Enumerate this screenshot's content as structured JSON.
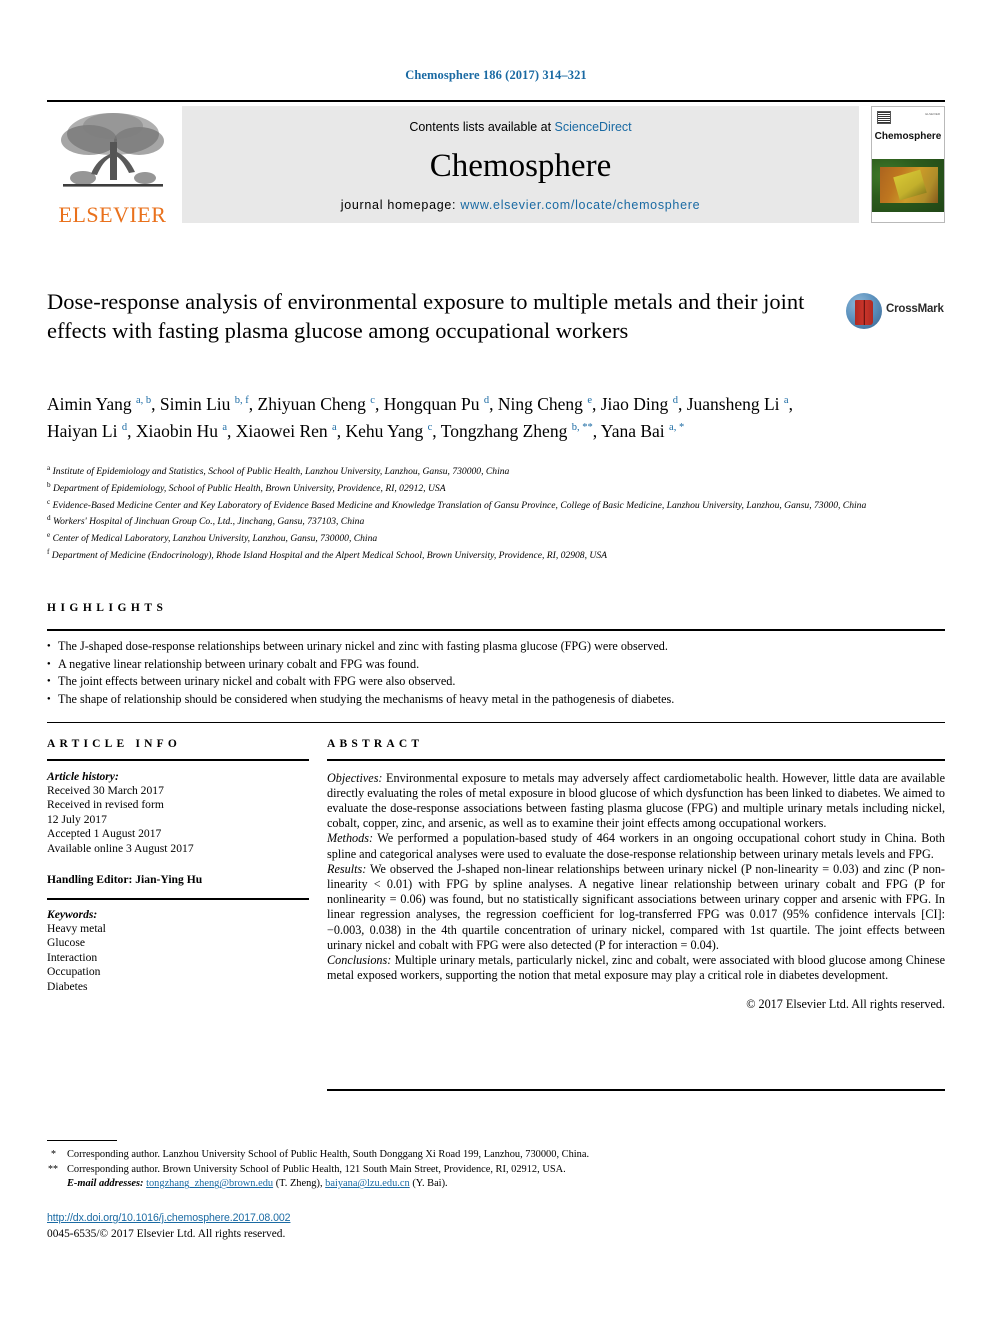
{
  "running_head": "Chemosphere 186 (2017) 314–321",
  "masthead": {
    "contents_prefix": "Contents lists available at ",
    "sciencedirect": "ScienceDirect",
    "journal_name": "Chemosphere",
    "homepage_prefix": "journal homepage: ",
    "homepage_url": "www.elsevier.com/locate/chemosphere",
    "publisher_logo_text": "ELSEVIER",
    "cover_title": "Chemosphere",
    "cover_corner_text": "ELSEVIER"
  },
  "article": {
    "title": "Dose-response analysis of environmental exposure to multiple metals and their joint effects with fasting plasma glucose among occupational workers",
    "crossmark_label": "CrossMark",
    "authors_html": "Aimin Yang <sup>a, b</sup>, Simin Liu <sup>b, f</sup>, Zhiyuan Cheng <sup>c</sup>, Hongquan Pu <sup>d</sup>, Ning Cheng <sup>e</sup>, Jiao Ding <sup>d</sup>, Juansheng Li <sup>a</sup>, Haiyan Li <sup>d</sup>, Xiaobin Hu <sup>a</sup>, Xiaowei Ren <sup>a</sup>, Kehu Yang <sup>c</sup>, Tongzhang Zheng <sup>b, **</sup>, Yana Bai <sup>a, *</sup>",
    "affiliations": [
      {
        "mark": "a",
        "text": "Institute of Epidemiology and Statistics, School of Public Health, Lanzhou University, Lanzhou, Gansu, 730000, China"
      },
      {
        "mark": "b",
        "text": "Department of Epidemiology, School of Public Health, Brown University, Providence, RI, 02912, USA"
      },
      {
        "mark": "c",
        "text": "Evidence-Based Medicine Center and Key Laboratory of Evidence Based Medicine and Knowledge Translation of Gansu Province, College of Basic Medicine, Lanzhou University, Lanzhou, Gansu, 73000, China"
      },
      {
        "mark": "d",
        "text": "Workers' Hospital of Jinchuan Group Co., Ltd., Jinchang, Gansu, 737103, China"
      },
      {
        "mark": "e",
        "text": "Center of Medical Laboratory, Lanzhou University, Lanzhou, Gansu, 730000, China"
      },
      {
        "mark": "f",
        "text": "Department of Medicine (Endocrinology), Rhode Island Hospital and the Alpert Medical School, Brown University, Providence, RI, 02908, USA"
      }
    ]
  },
  "highlights": {
    "heading": "HIGHLIGHTS",
    "items": [
      "The J-shaped dose-response relationships between urinary nickel and zinc with fasting plasma glucose (FPG) were observed.",
      "A negative linear relationship between urinary cobalt and FPG was found.",
      "The joint effects between urinary nickel and cobalt with FPG were also observed.",
      "The shape of relationship should be considered when studying the mechanisms of heavy metal in the pathogenesis of diabetes."
    ]
  },
  "article_info": {
    "heading": "ARTICLE INFO",
    "history_label": "Article history:",
    "history": [
      "Received 30 March 2017",
      "Received in revised form",
      "12 July 2017",
      "Accepted 1 August 2017",
      "Available online 3 August 2017"
    ],
    "handling_editor": "Handling Editor: Jian-Ying Hu",
    "keywords_label": "Keywords:",
    "keywords": [
      "Heavy metal",
      "Glucose",
      "Interaction",
      "Occupation",
      "Diabetes"
    ]
  },
  "abstract": {
    "heading": "ABSTRACT",
    "objectives_label": "Objectives:",
    "objectives_text": " Environmental exposure to metals may adversely affect cardiometabolic health. However, little data are available directly evaluating the roles of metal exposure in blood glucose of which dysfunction has been linked to diabetes. We aimed to evaluate the dose-response associations between fasting plasma glucose (FPG) and multiple urinary metals including nickel, cobalt, copper, zinc, and arsenic, as well as to examine their joint effects among occupational workers.",
    "methods_label": "Methods:",
    "methods_text": " We performed a population-based study of 464 workers in an ongoing occupational cohort study in China. Both spline and categorical analyses were used to evaluate the dose-response relationship between urinary metals levels and FPG.",
    "results_label": "Results:",
    "results_text": " We observed the J-shaped non-linear relationships between urinary nickel (P non-linearity = 0.03) and zinc (P non-linearity < 0.01) with FPG by spline analyses. A negative linear relationship between urinary cobalt and FPG (P for nonlinearity = 0.06) was found, but no statistically significant associations between urinary copper and arsenic with FPG. In linear regression analyses, the regression coefficient for log-transferred FPG was 0.017 (95% confidence intervals [CI]: −0.003, 0.038) in the 4th quartile concentration of urinary nickel, compared with 1st quartile. The joint effects between urinary nickel and cobalt with FPG were also detected (P for interaction = 0.04).",
    "conclusions_label": "Conclusions:",
    "conclusions_text": " Multiple urinary metals, particularly nickel, zinc and cobalt, were associated with blood glucose among Chinese metal exposed workers, supporting the notion that metal exposure may play a critical role in diabetes development.",
    "copyright": "© 2017 Elsevier Ltd. All rights reserved."
  },
  "footnotes": {
    "corr1_mark": "*",
    "corr1": "Corresponding author. Lanzhou University School of Public Health, South Donggang Xi Road 199, Lanzhou, 730000, China.",
    "corr2_mark": "**",
    "corr2": "Corresponding author. Brown University School of Public Health, 121 South Main Street, Providence, RI, 02912, USA.",
    "email_label": "E-mail addresses:",
    "email1": "tongzhang_zheng@brown.edu",
    "email1_attrib": " (T. Zheng), ",
    "email2": "baiyana@lzu.edu.cn",
    "email2_attrib": " (Y. Bai).",
    "doi": "http://dx.doi.org/10.1016/j.chemosphere.2017.08.002",
    "issn": "0045-6535/© 2017 Elsevier Ltd. All rights reserved."
  },
  "colors": {
    "link": "#1a6aa3",
    "elsevier_orange": "#E9711C",
    "greybar": "#e8e8e8"
  }
}
